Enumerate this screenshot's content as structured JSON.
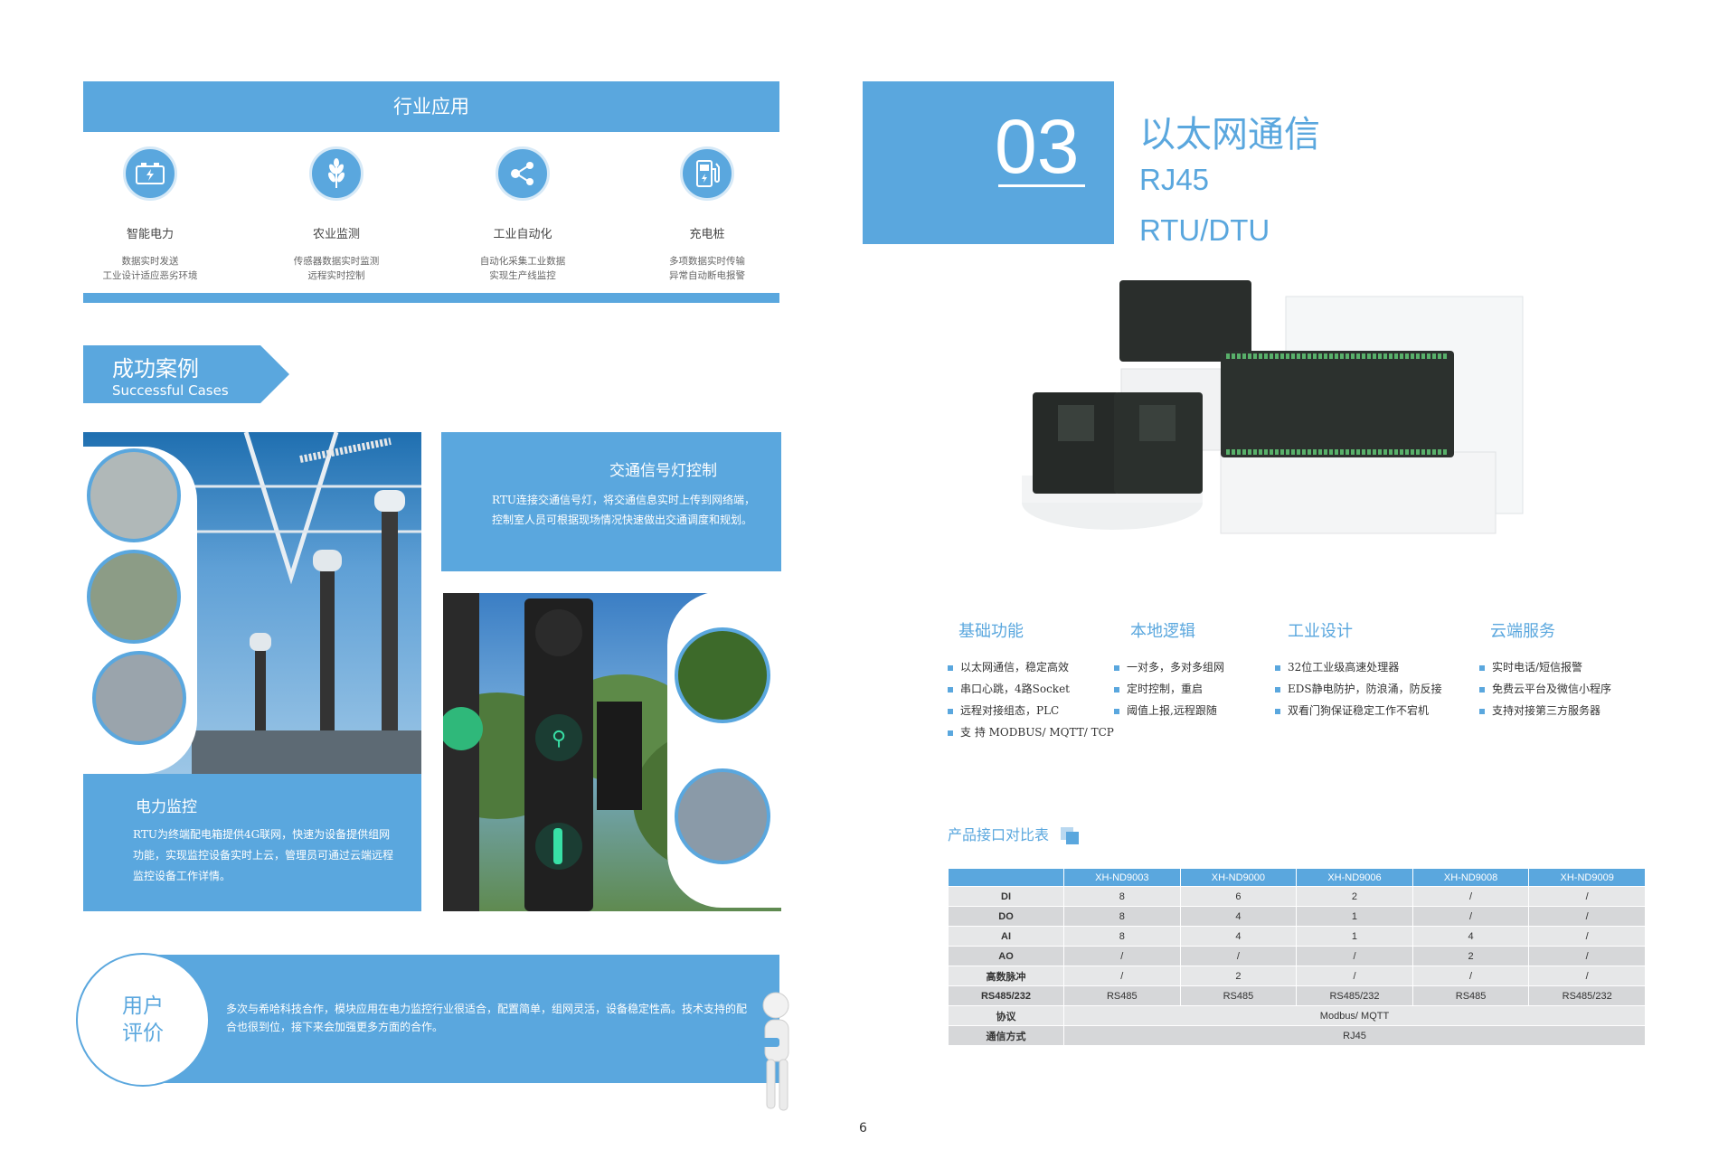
{
  "industry": {
    "title": "行业应用",
    "items": [
      {
        "icon": "battery-icon",
        "title": "智能电力",
        "desc": [
          "数据实时发送",
          "工业设计适应恶劣环境"
        ]
      },
      {
        "icon": "wheat-icon",
        "title": "农业监测",
        "desc": [
          "传感器数据实时监测",
          "远程实时控制"
        ]
      },
      {
        "icon": "network-share-icon",
        "title": "工业自动化",
        "desc": [
          "自动化采集工业数据",
          "实现生产线监控"
        ]
      },
      {
        "icon": "charging-pile-icon",
        "title": "充电桩",
        "desc": [
          "多项数据实时传输",
          "异常自动断电报警"
        ]
      }
    ]
  },
  "cases": {
    "title_zh": "成功案例",
    "title_en": "Successful Cases",
    "power": {
      "title": "电力监控",
      "desc": "RTU为终端配电箱提供4G联网，快速为设备提供组网功能，实现监控设备实时上云，管理员可通过云端远程监控设备工作详情。"
    },
    "traffic": {
      "title": "交通信号灯控制",
      "desc": "RTU连接交通信号灯，将交通信息实时上传到网络端，控制室人员可根据现场情况快速做出交通调度和规划。"
    }
  },
  "review": {
    "title_line1": "用户",
    "title_line2": "评价",
    "desc": "多次与希哈科技合作，模块应用在电力监控行业很适合，配置简单，组网灵活，设备稳定性高。技术支持的配合也很到位，接下来会加强更多方面的合作。"
  },
  "page_number": "6",
  "section": {
    "number": "03",
    "title": "以太网通信",
    "subtitle1": "RJ45",
    "subtitle2": "RTU/DTU"
  },
  "features": [
    {
      "title": "基础功能",
      "items": [
        "以太网通信，稳定高效",
        "串口心跳，4路Socket",
        "远程对接组态，PLC",
        "支 持 MODBUS/ MQTT/ TCP"
      ]
    },
    {
      "title": "本地逻辑",
      "items": [
        "一对多，多对多组网",
        "定时控制，重启",
        "阈值上报,远程跟随"
      ]
    },
    {
      "title": "工业设计",
      "items": [
        "32位工业级高速处理器",
        "EDS静电防护，防浪涌，防反接",
        "双看门狗保证稳定工作不宕机"
      ]
    },
    {
      "title": "云端服务",
      "items": [
        "实时电话/短信报警",
        "免费云平台及微信小程序",
        "支持对接第三方服务器"
      ]
    }
  ],
  "table": {
    "title": "产品接口对比表",
    "columns": [
      "",
      "XH-ND9003",
      "XH-ND9000",
      "XH-ND9006",
      "XH-ND9008",
      "XH-ND9009"
    ],
    "rows": [
      [
        "DI",
        "8",
        "6",
        "2",
        "/",
        "/"
      ],
      [
        "DO",
        "8",
        "4",
        "1",
        "/",
        "/"
      ],
      [
        "AI",
        "8",
        "4",
        "1",
        "4",
        "/"
      ],
      [
        "AO",
        "/",
        "/",
        "/",
        "2",
        "/"
      ],
      [
        "高数脉冲",
        "/",
        "2",
        "/",
        "/",
        "/"
      ],
      [
        "RS485/232",
        "RS485",
        "RS485",
        "RS485/232",
        "RS485",
        "RS485/232"
      ]
    ],
    "merged_rows": [
      [
        "协议",
        "Modbus/  MQTT"
      ],
      [
        "通信方式",
        "RJ45"
      ]
    ]
  },
  "colors": {
    "accent": "#5aa7de"
  }
}
